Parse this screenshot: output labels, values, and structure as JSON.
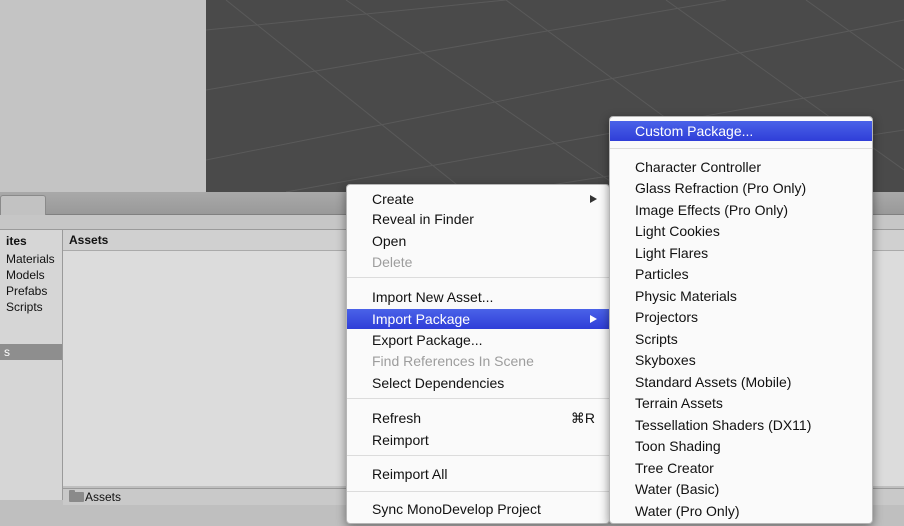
{
  "project_panel": {
    "left_header": "ites",
    "left_items": [
      "Materials",
      "Models",
      "Prefabs",
      "Scripts"
    ],
    "left_selected": "s",
    "assets_header": "Assets",
    "footer_path": "Assets"
  },
  "context_menu": {
    "items": [
      {
        "label": "Create",
        "state": "normal",
        "submenu": true
      },
      {
        "label": "Reveal in Finder",
        "state": "normal"
      },
      {
        "label": "Open",
        "state": "normal"
      },
      {
        "label": "Delete",
        "state": "disabled"
      },
      {
        "label": "Import New Asset...",
        "state": "normal"
      },
      {
        "label": "Import Package",
        "state": "highlighted",
        "submenu": true
      },
      {
        "label": "Export Package...",
        "state": "normal"
      },
      {
        "label": "Find References In Scene",
        "state": "disabled"
      },
      {
        "label": "Select Dependencies",
        "state": "normal"
      },
      {
        "label": "Refresh",
        "state": "normal",
        "shortcut": "⌘R"
      },
      {
        "label": "Reimport",
        "state": "normal"
      },
      {
        "label": "Reimport All",
        "state": "normal"
      },
      {
        "label": "Sync MonoDevelop Project",
        "state": "normal"
      }
    ]
  },
  "submenu": {
    "items": [
      {
        "label": "Custom Package...",
        "state": "highlighted"
      },
      {
        "label": "Character Controller"
      },
      {
        "label": "Glass Refraction (Pro Only)"
      },
      {
        "label": "Image Effects (Pro Only)"
      },
      {
        "label": "Light Cookies"
      },
      {
        "label": "Light Flares"
      },
      {
        "label": "Particles"
      },
      {
        "label": "Physic Materials"
      },
      {
        "label": "Projectors"
      },
      {
        "label": "Scripts"
      },
      {
        "label": "Skyboxes"
      },
      {
        "label": "Standard Assets (Mobile)"
      },
      {
        "label": "Terrain Assets"
      },
      {
        "label": "Tessellation Shaders (DX11)"
      },
      {
        "label": "Toon Shading"
      },
      {
        "label": "Tree Creator"
      },
      {
        "label": "Water (Basic)"
      },
      {
        "label": "Water (Pro Only)"
      }
    ]
  },
  "colors": {
    "highlight": "#3a4fe0",
    "scene_bg": "#4a4a4a"
  }
}
